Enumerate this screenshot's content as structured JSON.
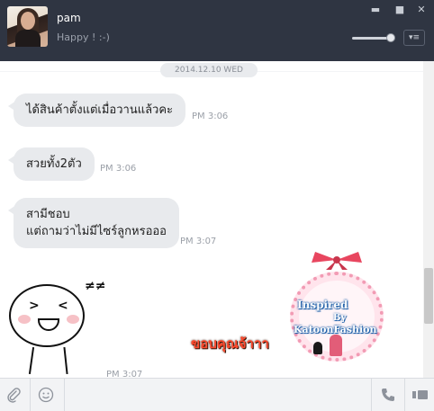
{
  "contact": {
    "name": "pam",
    "status": "Happy ! :-)"
  },
  "window": {
    "minimize": "▬",
    "maximize": "■",
    "close": "✕",
    "menu": "▾≡"
  },
  "chat": {
    "date_separator": "2014.12.10 WED",
    "messages": [
      {
        "lines": [
          "ได้สินค้าตั้งแต่เมื่อวานแล้วคะ"
        ],
        "time": "PM 3:06"
      },
      {
        "lines": [
          "สวยทั้ง2ตัว"
        ],
        "time": "PM 3:06"
      },
      {
        "lines": [
          "สามีชอบ",
          "แต่ถามว่าไม่มีไซร์ลูกหรอออ"
        ],
        "time": "PM 3:07"
      }
    ],
    "sticker": {
      "icon": "laughing-face-sticker-icon",
      "marks": "≠≠"
    },
    "image_message": {
      "badge": {
        "line1": "Inspired",
        "line2": "By",
        "line3": "KatoonFashion"
      },
      "caption": "ขอบคุณจ้าาา"
    },
    "partial_time": "PM 3:07"
  },
  "toolbar": {
    "attach_icon": "paperclip-icon",
    "emoji_icon": "smiley-icon",
    "call_icon": "phone-icon",
    "video_icon": "video-icon"
  },
  "colors": {
    "header_bg": "#2f3542",
    "bubble_bg": "#e8eaed",
    "toolbar_bg": "#f2f3f5",
    "caption": "#ff4a2e"
  }
}
